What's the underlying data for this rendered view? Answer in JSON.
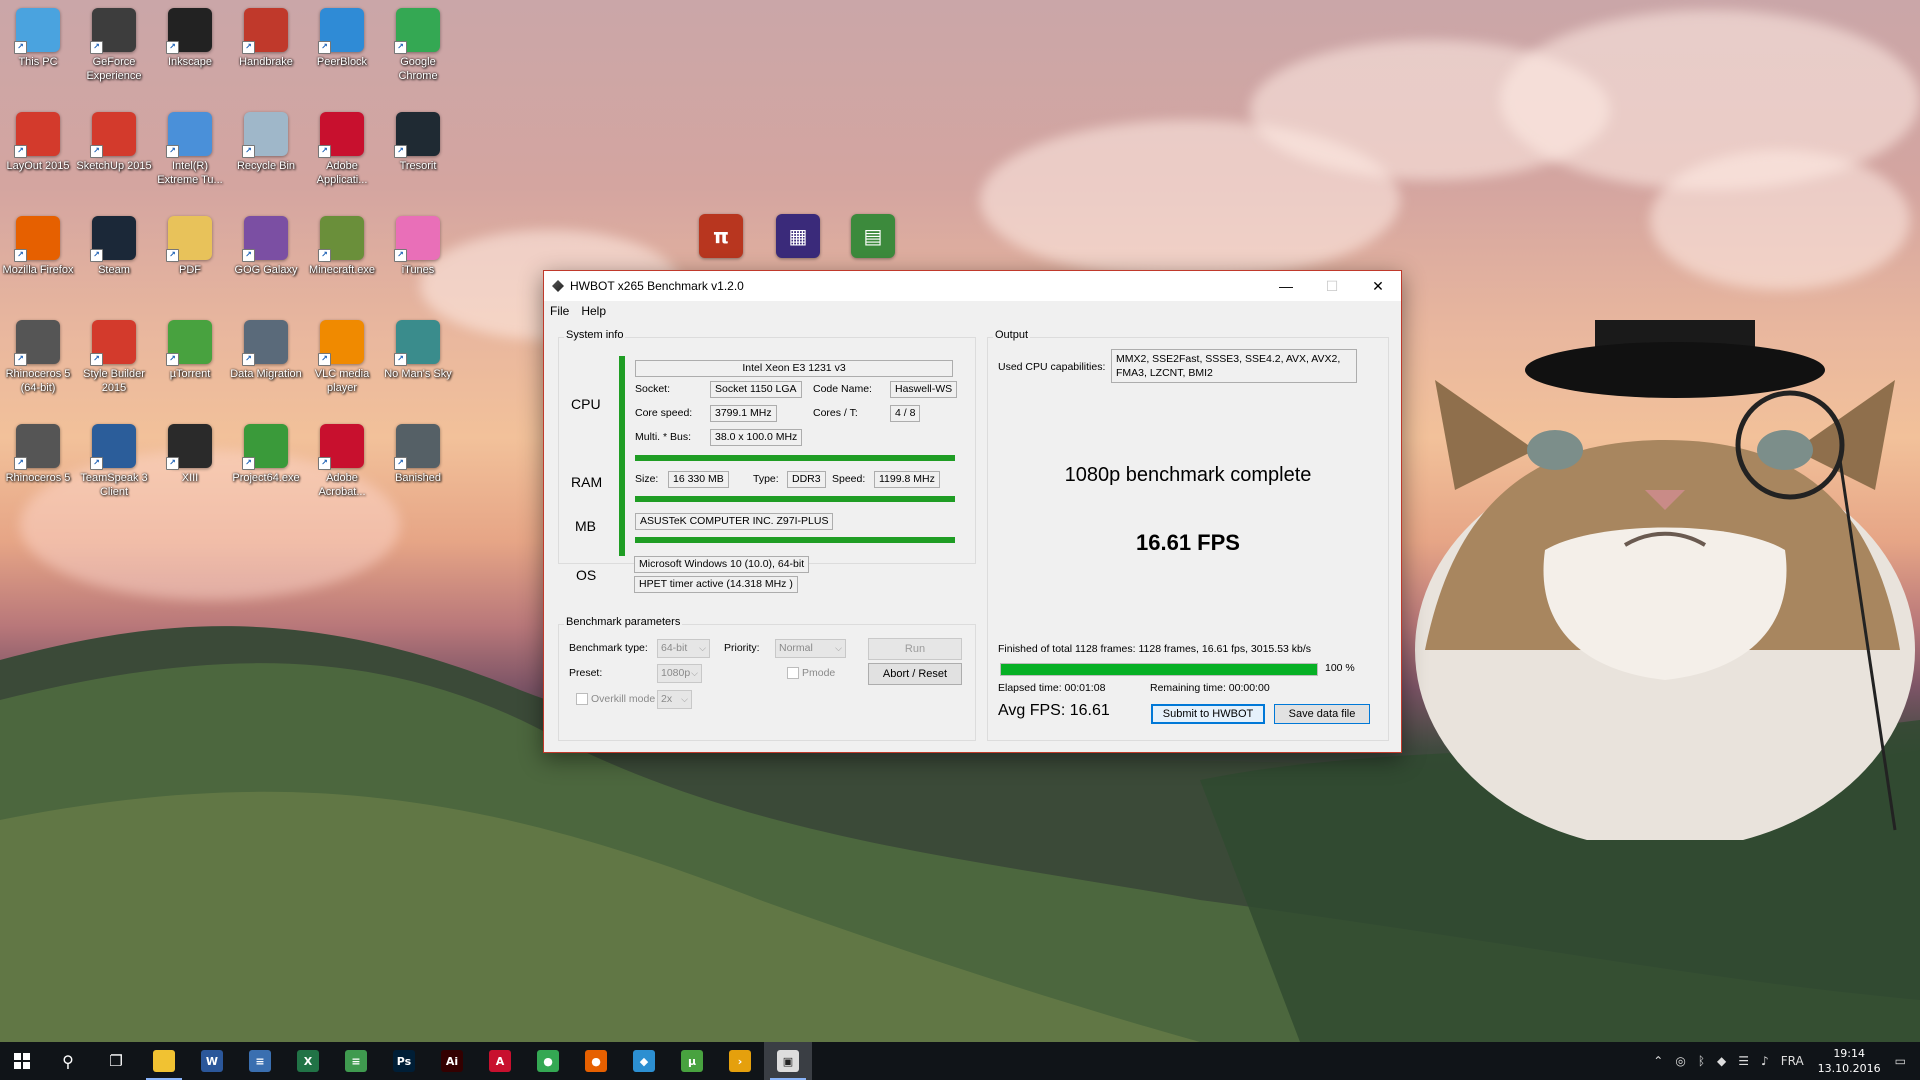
{
  "desktop": {
    "icons": [
      {
        "label": "This PC",
        "icon": "computer-icon",
        "color": "#4aa3df"
      },
      {
        "label": "GeForce Experience",
        "icon": "geforce-icon",
        "color": "#3d3d3d"
      },
      {
        "label": "Inkscape",
        "icon": "inkscape-icon",
        "color": "#222222"
      },
      {
        "label": "Handbrake",
        "icon": "handbrake-icon",
        "color": "#c0392b"
      },
      {
        "label": "PeerBlock",
        "icon": "peerblock-icon",
        "color": "#2f8bd6"
      },
      {
        "label": "Google Chrome",
        "icon": "chrome-icon",
        "color": "#34a853"
      },
      {
        "label": "LayOut 2015",
        "icon": "layout-icon",
        "color": "#d33a2c"
      },
      {
        "label": "SketchUp 2015",
        "icon": "sketchup-icon",
        "color": "#d33a2c"
      },
      {
        "label": "Intel(R) Extreme Tu...",
        "icon": "intel-xtu-icon",
        "color": "#4a90d9"
      },
      {
        "label": "Recycle Bin",
        "icon": "recycle-bin-icon",
        "color": "#9fb7c9"
      },
      {
        "label": "Adobe Applicati...",
        "icon": "adobe-icon",
        "color": "#c8102e"
      },
      {
        "label": "Tresorit",
        "icon": "tresorit-icon",
        "color": "#1f2a33"
      },
      {
        "label": "Mozilla Firefox",
        "icon": "firefox-icon",
        "color": "#e66000"
      },
      {
        "label": "Steam",
        "icon": "steam-icon",
        "color": "#1b2838"
      },
      {
        "label": "PDF",
        "icon": "pdf-folder-icon",
        "color": "#e8c25a"
      },
      {
        "label": "GOG Galaxy",
        "icon": "gog-icon",
        "color": "#7b4fa3"
      },
      {
        "label": "Minecraft.exe",
        "icon": "minecraft-icon",
        "color": "#6a8f3a"
      },
      {
        "label": "iTunes",
        "icon": "itunes-icon",
        "color": "#e96fb8"
      },
      {
        "label": "Rhinoceros 5 (64-bit)",
        "icon": "rhino-icon",
        "color": "#555555"
      },
      {
        "label": "Style Builder 2015",
        "icon": "stylebuilder-icon",
        "color": "#d33a2c"
      },
      {
        "label": "µTorrent",
        "icon": "utorrent-icon",
        "color": "#48a23f"
      },
      {
        "label": "Data Migration",
        "icon": "data-migration-icon",
        "color": "#5a6a7a"
      },
      {
        "label": "VLC media player",
        "icon": "vlc-icon",
        "color": "#f08a00"
      },
      {
        "label": "No Man's Sky",
        "icon": "nomanssky-icon",
        "color": "#3a8c8c"
      },
      {
        "label": "Rhinoceros 5",
        "icon": "rhino-icon",
        "color": "#555555"
      },
      {
        "label": "TeamSpeak 3 Client",
        "icon": "teamspeak-icon",
        "color": "#2b5d9a"
      },
      {
        "label": "XIII",
        "icon": "xiii-icon",
        "color": "#2a2a2a"
      },
      {
        "label": "Project64.exe",
        "icon": "project64-icon",
        "color": "#3a9a3a"
      },
      {
        "label": "Adobe Acrobat...",
        "icon": "acrobat-icon",
        "color": "#c8102e"
      },
      {
        "label": "Banished",
        "icon": "banished-icon",
        "color": "#556066"
      }
    ],
    "floating_icons": [
      {
        "icon": "superpi-icon",
        "color": "#b8361f"
      },
      {
        "icon": "cpuz-icon",
        "color": "#3a2a7a"
      },
      {
        "icon": "tool-icon",
        "color": "#3c8a3c"
      }
    ]
  },
  "window": {
    "title": "HWBOT x265 Benchmark v1.2.0",
    "menu": [
      "File",
      "Help"
    ],
    "system_info": {
      "group_label": "System info",
      "cpu_label": "CPU",
      "cpu_name": "Intel Xeon E3 1231 v3",
      "socket_label": "Socket:",
      "socket": "Socket 1150 LGA",
      "codename_label": "Code Name:",
      "codename": "Haswell-WS",
      "core_speed_label": "Core speed:",
      "core_speed": "3799.1 MHz",
      "cores_label": "Cores / T:",
      "cores": "4 / 8",
      "multi_label": "Multi. * Bus:",
      "multi": "38.0 x 100.0 MHz",
      "ram_label": "RAM",
      "size_label": "Size:",
      "size": "16 330 MB",
      "type_label": "Type:",
      "type": "DDR3",
      "speed_label": "Speed:",
      "speed": "1199.8 MHz",
      "mb_label": "MB",
      "mb": "ASUSTeK COMPUTER INC. Z97I-PLUS",
      "os_label": "OS",
      "os": "Microsoft Windows 10 (10.0), 64-bit",
      "timer": "HPET timer active (14.318 MHz )"
    },
    "benchmark_params": {
      "group_label": "Benchmark parameters",
      "type_label": "Benchmark type:",
      "type_value": "64-bit",
      "priority_label": "Priority:",
      "priority_value": "Normal",
      "run_label": "Run",
      "preset_label": "Preset:",
      "preset_value": "1080p",
      "pmode_label": "Pmode",
      "abort_label": "Abort / Reset",
      "overkill_label": "Overkill mode",
      "overkill_value": "2x"
    },
    "output": {
      "group_label": "Output",
      "cpu_caps_label": "Used CPU capabilities:",
      "cpu_caps": "MMX2, SSE2Fast, SSSE3, SSE4.2, AVX, AVX2, FMA3, LZCNT, BMI2",
      "status": "1080p benchmark complete",
      "fps": "16.61 FPS",
      "finished": "Finished of total 1128 frames: 1128 frames, 16.61 fps,  3015.53 kb/s",
      "progress_percent": 100,
      "progress_label": "100 %",
      "elapsed": "Elapsed time: 00:01:08",
      "remaining": "Remaining time: 00:00:00",
      "avg_fps": "Avg FPS: 16.61",
      "submit_label": "Submit to HWBOT",
      "save_label": "Save data file"
    }
  },
  "taskbar": {
    "apps": [
      {
        "icon": "file-explorer-icon",
        "color": "#f1c232",
        "text": ""
      },
      {
        "icon": "word-icon",
        "color": "#2b579a",
        "text": "W"
      },
      {
        "icon": "document-icon",
        "color": "#3a6fb0",
        "text": "≡"
      },
      {
        "icon": "excel-icon",
        "color": "#217346",
        "text": "X"
      },
      {
        "icon": "spreadsheet-icon",
        "color": "#3f9a4f",
        "text": "≡"
      },
      {
        "icon": "photoshop-icon",
        "color": "#001e36",
        "text": "Ps"
      },
      {
        "icon": "illustrator-icon",
        "color": "#330000",
        "text": "Ai"
      },
      {
        "icon": "acrobat-icon",
        "color": "#c8102e",
        "text": "A"
      },
      {
        "icon": "chrome-icon",
        "color": "#34a853",
        "text": "●"
      },
      {
        "icon": "firefox-icon",
        "color": "#e66000",
        "text": "●"
      },
      {
        "icon": "tresorit-icon",
        "color": "#2c8fd1",
        "text": "◆"
      },
      {
        "icon": "utorrent-icon",
        "color": "#48a23f",
        "text": "µ"
      },
      {
        "icon": "plex-icon",
        "color": "#e5a00d",
        "text": "›"
      },
      {
        "icon": "benchmark-icon",
        "color": "#dddddd",
        "text": "▣"
      }
    ],
    "language": "FRA",
    "time": "19:14",
    "date": "13.10.2016"
  }
}
